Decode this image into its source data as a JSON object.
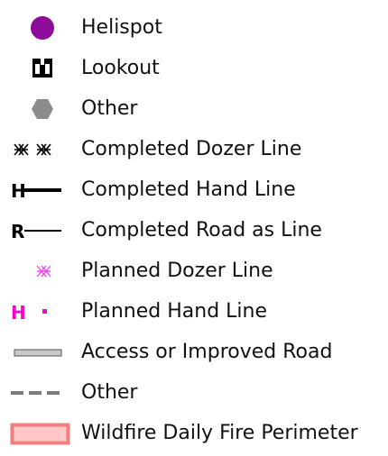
{
  "legend": {
    "items": [
      {
        "label": "Helispot",
        "icon": "helispot-circle-icon",
        "color": "#8e0c9a"
      },
      {
        "label": "Lookout",
        "icon": "binoculars-icon",
        "color": "#000000"
      },
      {
        "label": "Other",
        "icon": "hexagon-icon",
        "color": "#8c8c8c"
      },
      {
        "label": "Completed Dozer Line",
        "icon": "dozer-line-icon",
        "color": "#000000"
      },
      {
        "label": "Completed Hand Line",
        "icon": "hand-line-icon",
        "color": "#000000",
        "symbol_text": "H"
      },
      {
        "label": "Completed Road as Line",
        "icon": "road-line-icon",
        "color": "#000000",
        "symbol_text": "R"
      },
      {
        "label": "Planned Dozer Line",
        "icon": "planned-dozer-line-icon",
        "color": "#ff33ff"
      },
      {
        "label": "Planned Hand Line",
        "icon": "planned-hand-line-icon",
        "color": "#ff00cc",
        "symbol_text": "H"
      },
      {
        "label": "Access or Improved Road",
        "icon": "improved-road-icon",
        "color": "#c8c8c8"
      },
      {
        "label": "Other",
        "icon": "dashed-line-icon",
        "color": "#7a7a7a"
      },
      {
        "label": "Wildfire Daily Fire Perimeter",
        "icon": "fire-perimeter-icon",
        "color": "#f07f7f",
        "fill": "#ffc7c7"
      }
    ]
  }
}
